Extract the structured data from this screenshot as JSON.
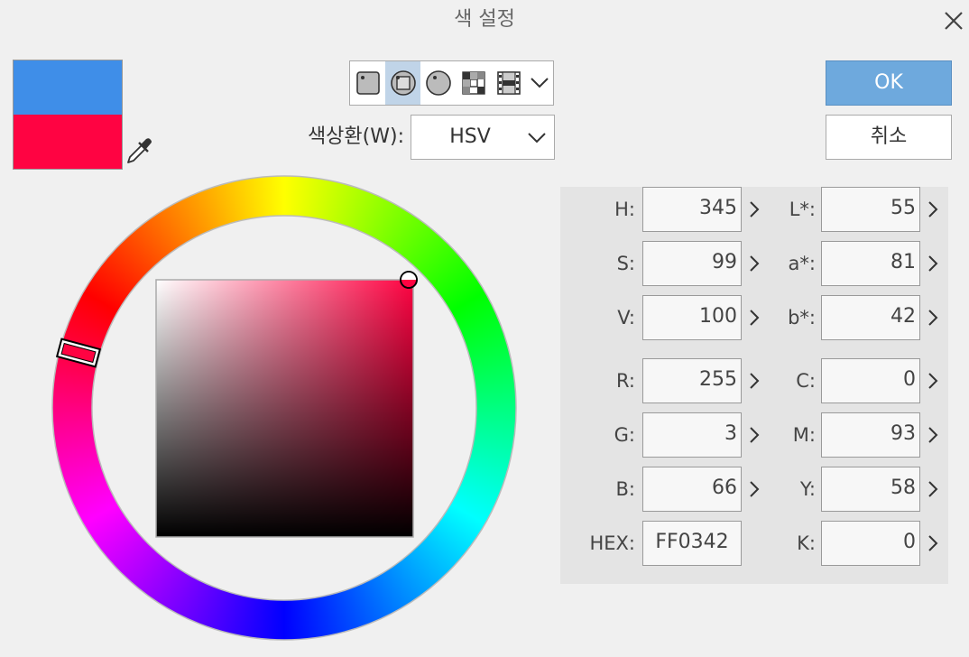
{
  "dialog": {
    "title": "색 설정"
  },
  "colors": {
    "new_color": "#3f8ee8",
    "current_color": "#ff0342",
    "selected_tool_bg": "#c0d4e8",
    "ok_button_bg": "#6ea9dd"
  },
  "toolbar": {
    "icons": [
      "solid-square-icon",
      "wheel-square-icon",
      "circle-icon",
      "checker-icon",
      "film-icon",
      "chevron-down-icon"
    ],
    "selected_index": 1
  },
  "wheel_selector": {
    "label": "색상환(W):",
    "value": "HSV"
  },
  "buttons": {
    "ok": "OK",
    "cancel": "취소"
  },
  "fields": {
    "h": {
      "label": "H:",
      "value": "345"
    },
    "s": {
      "label": "S:",
      "value": "99"
    },
    "v": {
      "label": "V:",
      "value": "100"
    },
    "r": {
      "label": "R:",
      "value": "255"
    },
    "g": {
      "label": "G:",
      "value": "3"
    },
    "b": {
      "label": "B:",
      "value": "66"
    },
    "hex": {
      "label": "HEX:",
      "value": "FF0342"
    },
    "l": {
      "label": "L*:",
      "value": "55"
    },
    "a": {
      "label": "a*:",
      "value": "81"
    },
    "bb": {
      "label": "b*:",
      "value": "42"
    },
    "c": {
      "label": "C:",
      "value": "0"
    },
    "m": {
      "label": "M:",
      "value": "93"
    },
    "y": {
      "label": "Y:",
      "value": "58"
    },
    "k": {
      "label": "K:",
      "value": "0"
    }
  },
  "color_wheel": {
    "hue": 345,
    "saturation": 99,
    "value": 100
  }
}
